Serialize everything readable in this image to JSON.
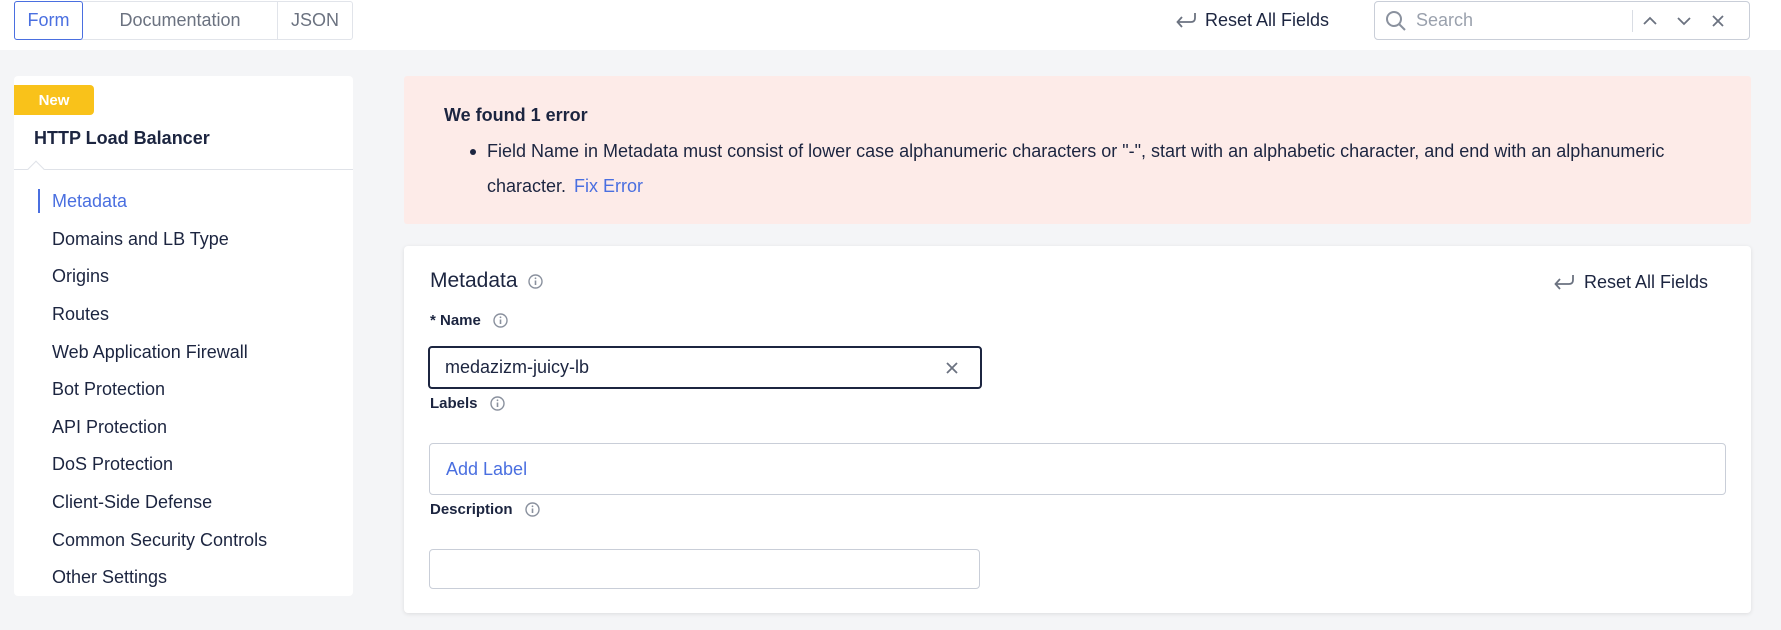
{
  "tabs": [
    {
      "label": "Form",
      "active": true
    },
    {
      "label": "Documentation",
      "active": false
    },
    {
      "label": "JSON",
      "active": false
    }
  ],
  "toolbar": {
    "reset_label": "Reset All Fields",
    "search_placeholder": "Search",
    "search_value": ""
  },
  "sidebar": {
    "badge": "New",
    "title": "HTTP Load Balancer",
    "items": [
      {
        "label": "Metadata",
        "active": true
      },
      {
        "label": "Domains and LB Type"
      },
      {
        "label": "Origins"
      },
      {
        "label": "Routes"
      },
      {
        "label": "Web Application Firewall"
      },
      {
        "label": "Bot Protection"
      },
      {
        "label": "API Protection"
      },
      {
        "label": "DoS Protection"
      },
      {
        "label": "Client-Side Defense"
      },
      {
        "label": "Common Security Controls"
      },
      {
        "label": "Other Settings"
      }
    ]
  },
  "error": {
    "title": "We found 1 error",
    "message": "Field Name in Metadata must consist of lower case alphanumeric characters or \"-\", start with an alphabetic character, and end with an alphanumeric character.",
    "fix_label": "Fix Error"
  },
  "metadata": {
    "title": "Metadata",
    "reset_label": "Reset All Fields",
    "name_label": "* Name",
    "name_value": "medazizm-juicy-lb",
    "labels_label": "Labels",
    "add_label": "Add Label",
    "description_label": "Description",
    "description_value": ""
  },
  "colors": {
    "accent": "#4a6fe0",
    "badge": "#f9c21a",
    "error_bg": "#fdebe8",
    "text": "#1c2540"
  },
  "icons": {
    "reset": "undo-arrow-icon",
    "search": "search-icon",
    "prev": "chevron-up-icon",
    "next": "chevron-down-icon",
    "close": "close-icon",
    "info": "info-icon",
    "clear": "clear-icon"
  }
}
